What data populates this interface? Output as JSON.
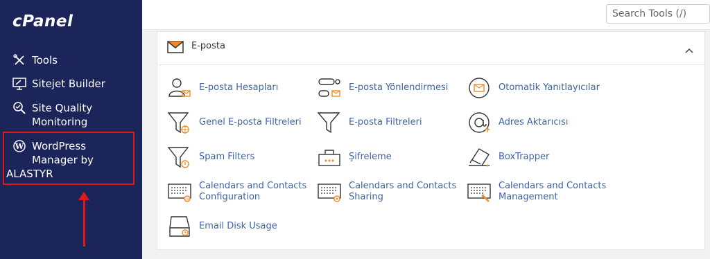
{
  "brand": {
    "logo_text": "cPanel"
  },
  "sidebar": {
    "items": [
      {
        "label": "Tools",
        "icon": "tools-icon"
      },
      {
        "label": "Sitejet Builder",
        "icon": "sitejet-icon"
      },
      {
        "label_line1": "Site Quality",
        "label_line2": "Monitoring",
        "icon": "magnifier-check-icon"
      },
      {
        "label_line1": "WordPress",
        "label_line2": "Manager by",
        "label_line3": "ALASTYR",
        "icon": "wordpress-icon"
      }
    ]
  },
  "topbar": {
    "search_placeholder": "Search Tools (/)"
  },
  "email_section": {
    "title": "E-posta",
    "items": [
      {
        "label": "E-posta Hesapları",
        "icon": "email-accounts-icon"
      },
      {
        "label": "E-posta Yönlendirmesi",
        "icon": "forwarders-icon"
      },
      {
        "label": "Otomatik Yanıtlayıcılar",
        "icon": "autoresponders-icon"
      },
      {
        "label": "Genel E-posta Filtreleri",
        "icon": "global-filter-icon"
      },
      {
        "label": "E-posta Filtreleri",
        "icon": "filter-icon"
      },
      {
        "label": "Adres Aktarıcısı",
        "icon": "at-sign-icon"
      },
      {
        "label": "Spam Filters",
        "icon": "spam-filter-icon"
      },
      {
        "label": "Şifreleme",
        "icon": "encryption-icon"
      },
      {
        "label": "BoxTrapper",
        "icon": "boxtrapper-icon"
      },
      {
        "label_line1": "Calendars and Contacts",
        "label_line2": "Configuration",
        "icon": "calendar-config-icon"
      },
      {
        "label_line1": "Calendars and Contacts",
        "label_line2": "Sharing",
        "icon": "calendar-sharing-icon"
      },
      {
        "label_line1": "Calendars and Contacts",
        "label_line2": "Management",
        "icon": "calendar-management-icon"
      },
      {
        "label": "Email Disk Usage",
        "icon": "disk-usage-icon"
      }
    ]
  },
  "colors": {
    "sidebar_bg": "#1b2559",
    "link": "#3e63a8",
    "accent_orange": "#f08a24",
    "annotation_red": "#e01818"
  }
}
